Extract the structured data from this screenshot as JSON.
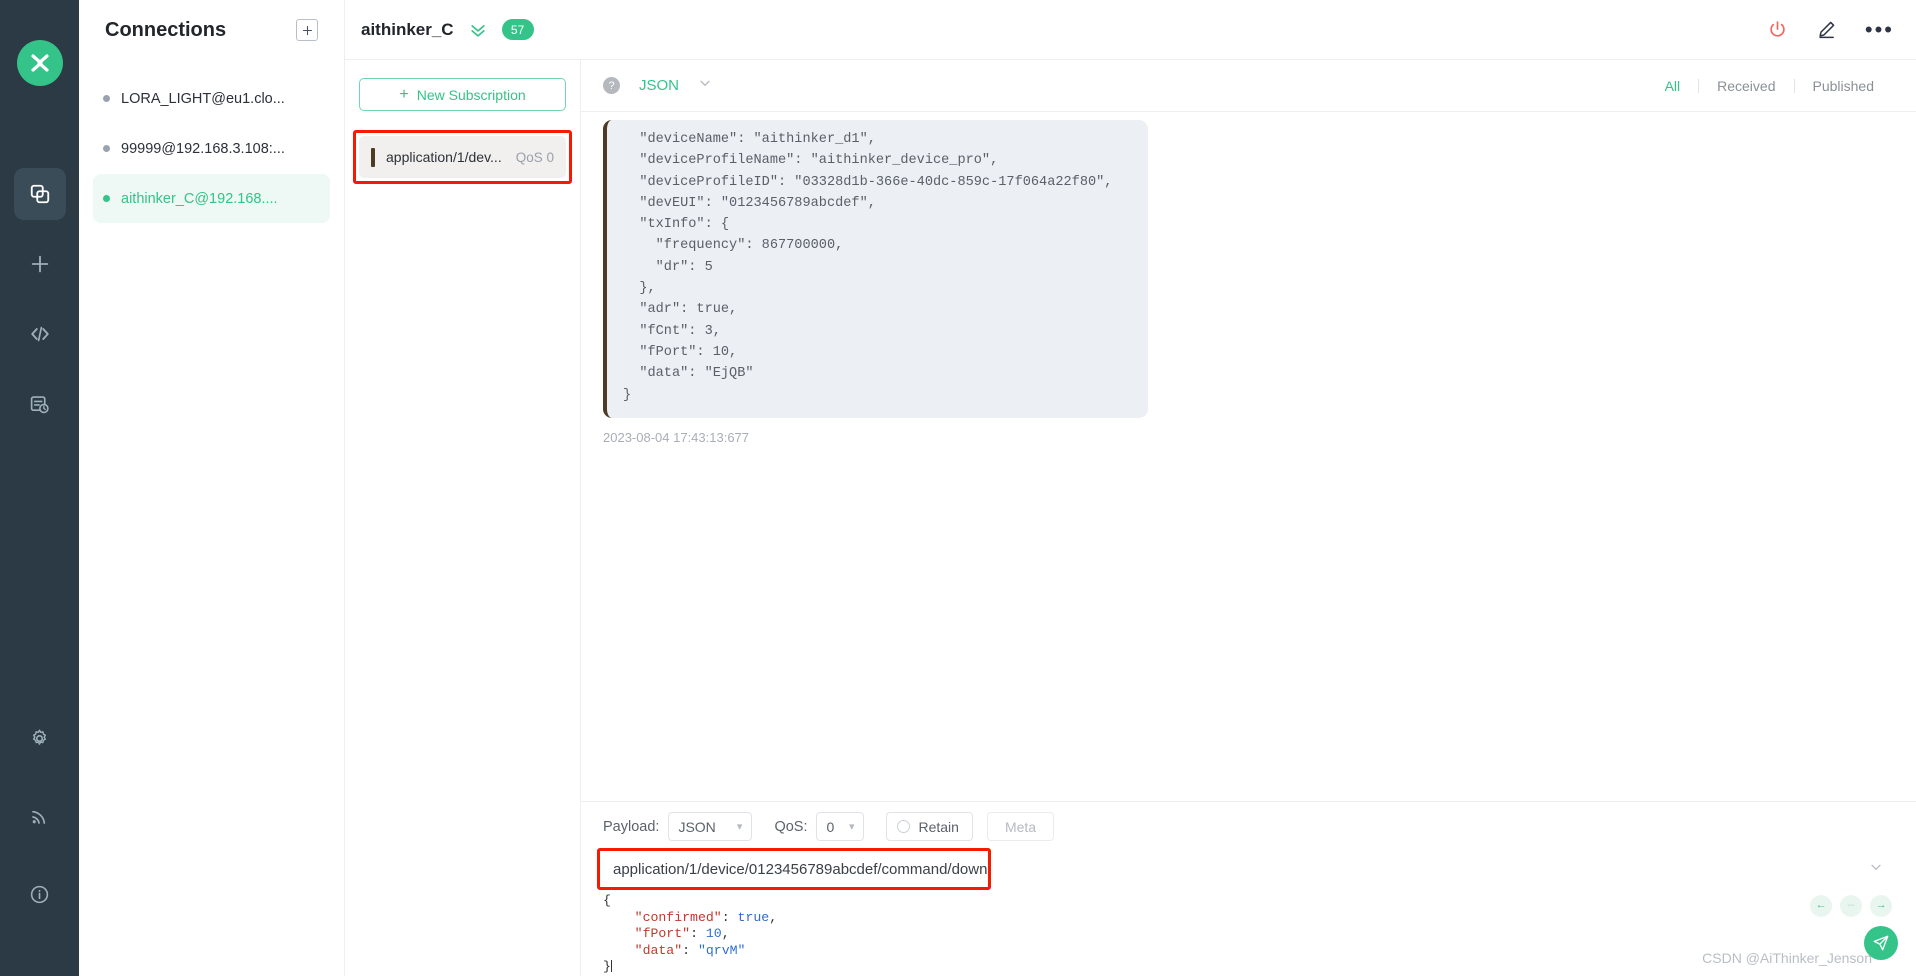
{
  "rail": {
    "logo_icon": "mqttx-logo-icon",
    "items": [
      {
        "name": "connections",
        "icon": "copy-stack-icon",
        "active": true
      },
      {
        "name": "new-connection",
        "icon": "plus-icon",
        "active": false
      },
      {
        "name": "scripts",
        "icon": "code-brackets-icon",
        "active": false
      },
      {
        "name": "log",
        "icon": "log-clock-icon",
        "active": false
      }
    ],
    "bottom_items": [
      {
        "name": "settings",
        "icon": "gear-icon"
      },
      {
        "name": "broker",
        "icon": "signal-icon"
      },
      {
        "name": "about",
        "icon": "info-circle-icon"
      }
    ]
  },
  "sidebar": {
    "title": "Connections",
    "add_icon": "plus-box-icon",
    "items": [
      {
        "label": "LORA_LIGHT@eu1.clo...",
        "active": false
      },
      {
        "label": "99999@192.168.3.108:...",
        "active": false
      },
      {
        "label": "aithinker_C@192.168....",
        "active": true
      }
    ]
  },
  "header": {
    "connection_name": "aithinker_C",
    "collapse_icon": "double-chevron-down-icon",
    "badge_count": "57",
    "disconnect_icon": "power-icon",
    "edit_icon": "pencil-icon",
    "more_icon": "more-dots-icon"
  },
  "subscriptions": {
    "new_button_label": "New Subscription",
    "new_button_icon": "plus-icon",
    "items": [
      {
        "topic": "application/1/dev...",
        "qos": "QoS 0",
        "color": "#4e3b23",
        "highlighted": true
      }
    ]
  },
  "messages_toolbar": {
    "help_icon": "question-mark-icon",
    "format": "JSON",
    "format_chevron_icon": "chevron-down-icon",
    "filters": [
      {
        "label": "All",
        "active": true
      },
      {
        "label": "Received",
        "active": false
      },
      {
        "label": "Published",
        "active": false
      }
    ]
  },
  "message": {
    "accent_color": "#4e3b23",
    "body": "  \"deviceName\": \"aithinker_d1\",\n  \"deviceProfileName\": \"aithinker_device_pro\",\n  \"deviceProfileID\": \"03328d1b-366e-40dc-859c-17f064a22f80\",\n  \"devEUI\": \"0123456789abcdef\",\n  \"txInfo\": {\n    \"frequency\": 867700000,\n    \"dr\": 5\n  },\n  \"adr\": true,\n  \"fCnt\": 3,\n  \"fPort\": 10,\n  \"data\": \"EjQB\"\n}",
    "timestamp": "2023-08-04 17:43:13:677"
  },
  "publish": {
    "payload_label": "Payload:",
    "payload_value": "JSON",
    "qos_label": "QoS:",
    "qos_value": "0",
    "retain_label": "Retain",
    "meta_label": "Meta",
    "topic_value": "application/1/device/0123456789abcdef/command/down",
    "topic_chevron_icon": "chevron-down-icon",
    "send_icon": "send-plane-icon",
    "nav_prev_icon": "arrow-left-icon",
    "nav_mid_icon": "minus-icon",
    "nav_next_icon": "arrow-right-icon",
    "editor_lines": [
      {
        "segments": [
          {
            "t": "{",
            "c": "pn"
          }
        ]
      },
      {
        "segments": [
          {
            "t": "    ",
            "c": "pn"
          },
          {
            "t": "\"confirmed\"",
            "c": "k"
          },
          {
            "t": ": ",
            "c": "pn"
          },
          {
            "t": "true",
            "c": "bl"
          },
          {
            "t": ",",
            "c": "pn"
          }
        ]
      },
      {
        "segments": [
          {
            "t": "    ",
            "c": "pn"
          },
          {
            "t": "\"fPort\"",
            "c": "k"
          },
          {
            "t": ": ",
            "c": "pn"
          },
          {
            "t": "10",
            "c": "bl"
          },
          {
            "t": ",",
            "c": "pn"
          }
        ]
      },
      {
        "segments": [
          {
            "t": "    ",
            "c": "pn"
          },
          {
            "t": "\"data\"",
            "c": "k"
          },
          {
            "t": ": ",
            "c": "pn"
          },
          {
            "t": "\"qrvM\"",
            "c": "bl"
          }
        ]
      },
      {
        "segments": [
          {
            "t": "}",
            "c": "pn"
          }
        ]
      }
    ]
  },
  "watermark": "CSDN @AiThinker_Jenson",
  "colors": {
    "accent_green": "#34c388",
    "rail_bg": "#2b3a45",
    "annotation_red": "#f61b00",
    "message_accent": "#4e3b23"
  }
}
